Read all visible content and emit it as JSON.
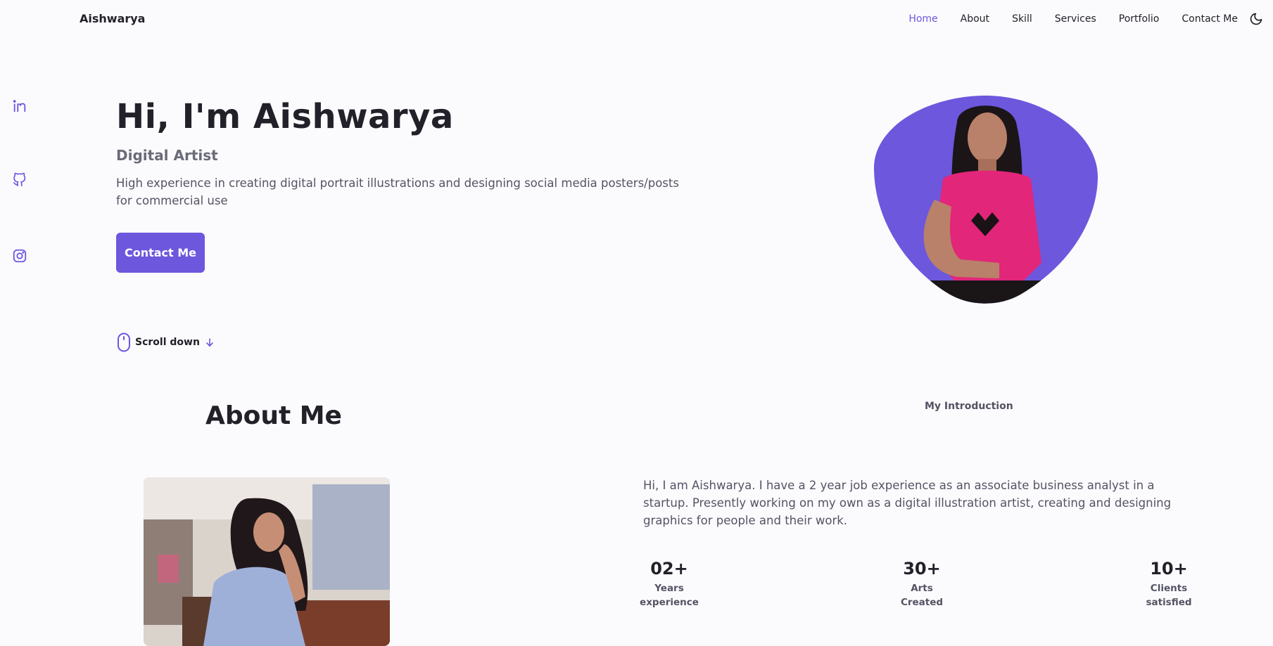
{
  "header": {
    "logo": "Aishwarya",
    "nav": [
      "Home",
      "About",
      "Skill",
      "Services",
      "Portfolio",
      "Contact Me"
    ],
    "active": "Home",
    "theme_icon": "moon-icon"
  },
  "social": [
    {
      "name": "linkedin-icon"
    },
    {
      "name": "github-icon"
    },
    {
      "name": "instagram-icon"
    }
  ],
  "hero": {
    "title": "Hi, I'm Aishwarya",
    "subtitle": "Digital Artist",
    "description": "High experience in creating digital portrait illustrations and designing social media posters/posts for commercial use",
    "cta": "Contact Me",
    "scroll": "Scroll down"
  },
  "about": {
    "title": "About Me",
    "kicker": "My Introduction",
    "text": "Hi, I am Aishwarya. I have a 2 year job experience as an associate business analyst in a startup. Presently working on my own as a digital illustration artist, creating and designing graphics for people and their work.",
    "stats": [
      {
        "number": "02+",
        "line1": "Years",
        "line2": "experience"
      },
      {
        "number": "30+",
        "line1": "Arts",
        "line2": "Created"
      },
      {
        "number": "10+",
        "line1": "Clients",
        "line2": "satisfied"
      }
    ]
  },
  "colors": {
    "accent": "#6d57dd",
    "background": "#fbfbfe",
    "text": "#222129",
    "muted": "#545363"
  }
}
